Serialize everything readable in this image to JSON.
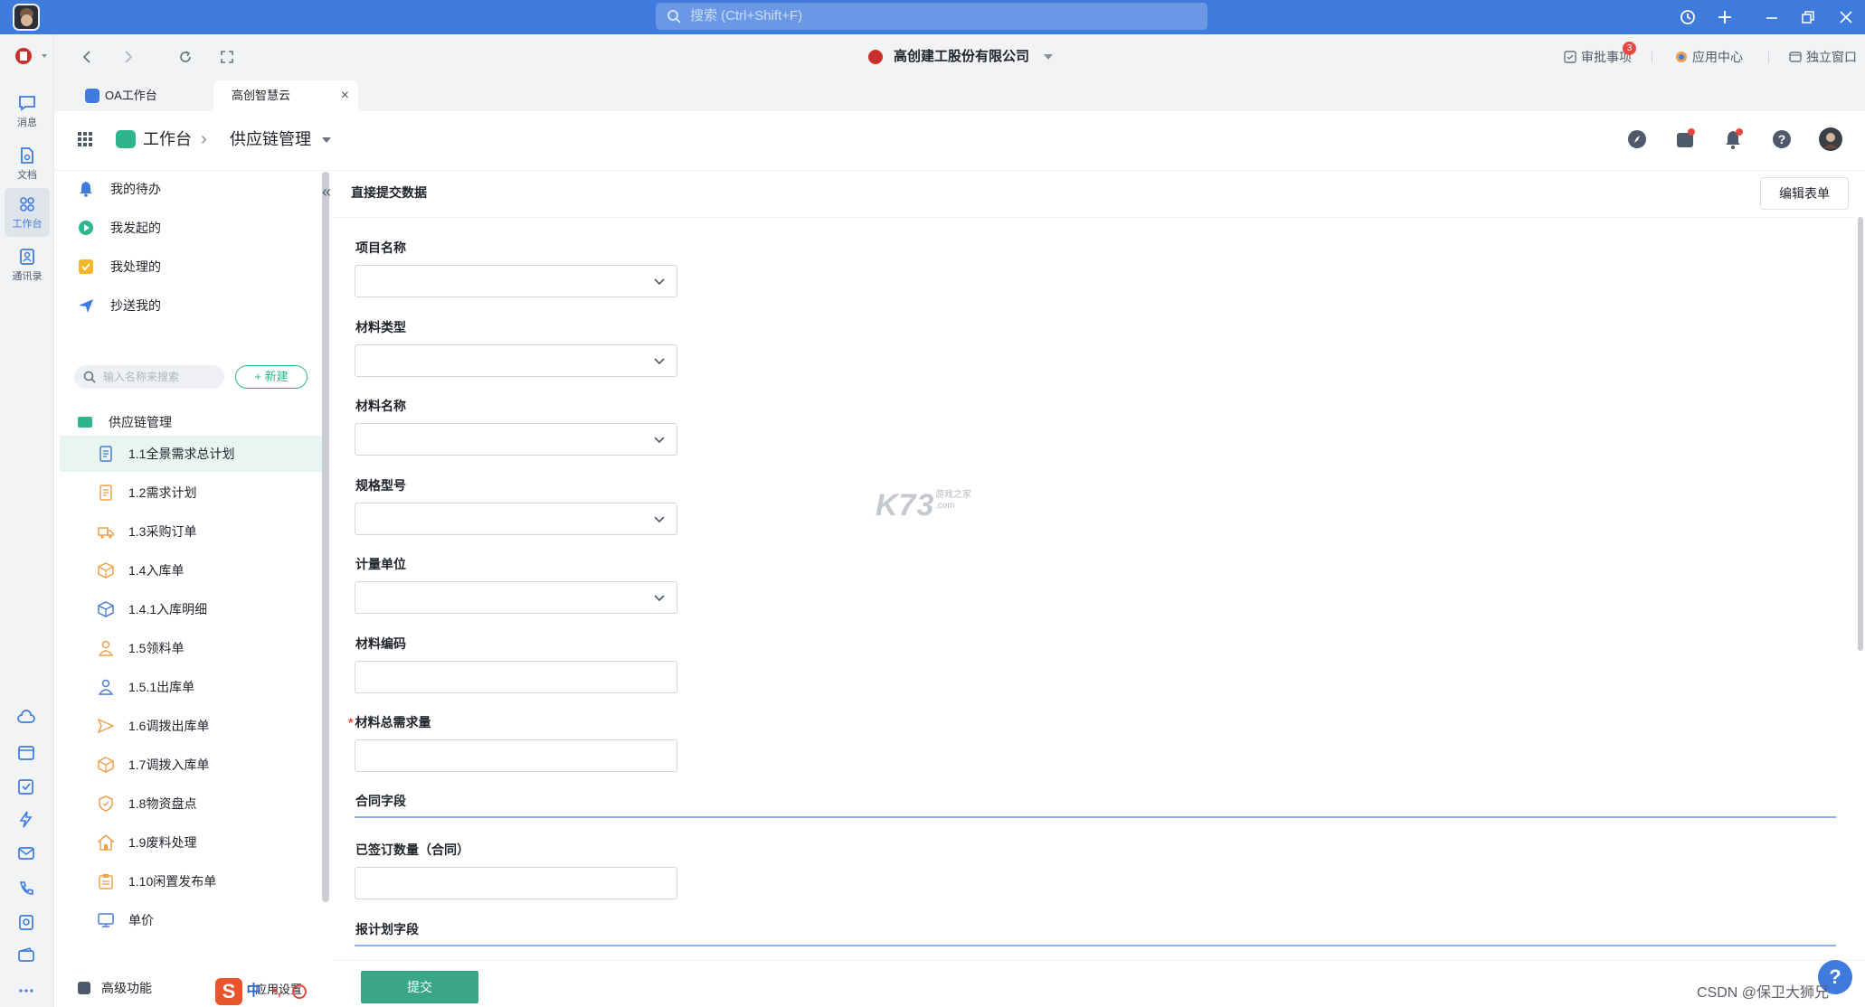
{
  "titlebar": {
    "search_placeholder": "搜索 (Ctrl+Shift+F)"
  },
  "rail": {
    "items": [
      {
        "label": "消息"
      },
      {
        "label": "文档"
      },
      {
        "label": "工作台"
      },
      {
        "label": "通讯录"
      }
    ]
  },
  "topnav": {
    "company": "高创建工股份有限公司",
    "approve_label": "审批事项",
    "approve_badge": "3",
    "app_center": "应用中心",
    "standalone": "独立窗口"
  },
  "tabs": [
    {
      "label": "OA工作台"
    },
    {
      "label": "高创智慧云"
    }
  ],
  "breadcrumb": {
    "home": "工作台",
    "current": "供应链管理"
  },
  "sidebar": {
    "todo": [
      {
        "label": "我的待办",
        "color": "#3e7bdc"
      },
      {
        "label": "我发起的",
        "color": "#2fb58c"
      },
      {
        "label": "我处理的",
        "color": "#f5b62a"
      },
      {
        "label": "抄送我的",
        "color": "#3e7bdc"
      }
    ],
    "search_placeholder": "输入名称来搜索",
    "new_label": "+ 新建",
    "folder": "供应链管理",
    "forms": [
      {
        "label": "1.1全景需求总计划",
        "icon": "doc-icon",
        "color": "#4a7bd0"
      },
      {
        "label": "1.2需求计划",
        "icon": "doc-icon",
        "color": "#f0a04b"
      },
      {
        "label": "1.3采购订单",
        "icon": "truck-icon",
        "color": "#f0a04b"
      },
      {
        "label": "1.4入库单",
        "icon": "box-icon",
        "color": "#f0a04b"
      },
      {
        "label": "1.4.1入库明细",
        "icon": "box-icon",
        "color": "#4a7bd0"
      },
      {
        "label": "1.5领料单",
        "icon": "person-icon",
        "color": "#f0a04b"
      },
      {
        "label": "1.5.1出库单",
        "icon": "person-icon",
        "color": "#4a7bd0"
      },
      {
        "label": "1.6调拨出库单",
        "icon": "send-icon",
        "color": "#f0a04b"
      },
      {
        "label": "1.7调拨入库单",
        "icon": "box-icon",
        "color": "#f0a04b"
      },
      {
        "label": "1.8物资盘点",
        "icon": "shield-icon",
        "color": "#f0a04b"
      },
      {
        "label": "1.9废料处理",
        "icon": "home-icon",
        "color": "#f0a04b"
      },
      {
        "label": "1.10闲置发布单",
        "icon": "clipboard-icon",
        "color": "#f0a04b"
      },
      {
        "label": "单价",
        "icon": "monitor-icon",
        "color": "#4a7bd0"
      }
    ],
    "advanced": "高级功能",
    "app_settings": "应用设置"
  },
  "form": {
    "title": "直接提交数据",
    "edit_button": "编辑表单",
    "fields": [
      {
        "label": "项目名称",
        "type": "select",
        "required": false
      },
      {
        "label": "材料类型",
        "type": "select",
        "required": false
      },
      {
        "label": "材料名称",
        "type": "select",
        "required": false
      },
      {
        "label": "规格型号",
        "type": "select",
        "required": false
      },
      {
        "label": "计量单位",
        "type": "select",
        "required": false
      },
      {
        "label": "材料编码",
        "type": "input",
        "required": false
      },
      {
        "label": "材料总需求量",
        "type": "input",
        "required": true
      }
    ],
    "section_contract": "合同字段",
    "signed_qty_label": "已签订数量（合同）",
    "section_plan": "报计划字段",
    "submit": "提交"
  },
  "overlay": {
    "ime": "中",
    "csdn": "CSDN @保卫大狮兄",
    "watermark": "K73",
    "watermark_sub_1": "游戏之家",
    "watermark_sub_2": ".com"
  },
  "colors": {
    "accent": "#3e7bdc",
    "primary_green": "#3aa587",
    "danger": "#e5483f"
  }
}
